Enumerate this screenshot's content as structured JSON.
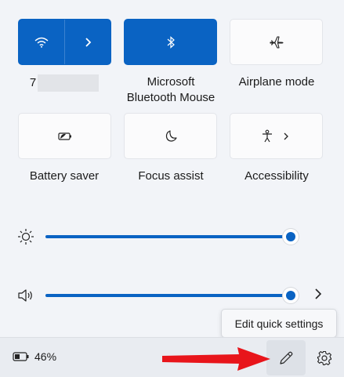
{
  "tiles": [
    {
      "label_left": "7",
      "label_right": "",
      "state": "on",
      "icon": "wifi-icon"
    },
    {
      "label_line1": "Microsoft",
      "label_line2": "Bluetooth Mouse",
      "state": "on",
      "icon": "bluetooth-icon"
    },
    {
      "label": "Airplane mode",
      "state": "off",
      "icon": "airplane-icon"
    },
    {
      "label": "Battery saver",
      "state": "off",
      "icon": "battery-saver-icon"
    },
    {
      "label": "Focus assist",
      "state": "off",
      "icon": "moon-icon"
    },
    {
      "label": "Accessibility",
      "state": "off",
      "icon": "accessibility-icon"
    }
  ],
  "sliders": {
    "brightness": {
      "icon": "brightness-icon",
      "level": 1.0
    },
    "volume": {
      "icon": "speaker-icon",
      "level": 1.0
    }
  },
  "tooltip": {
    "text": "Edit quick settings"
  },
  "footer": {
    "battery_percent": "46%"
  },
  "colors": {
    "accent": "#0a63c3",
    "arrow": "#e8151b"
  }
}
